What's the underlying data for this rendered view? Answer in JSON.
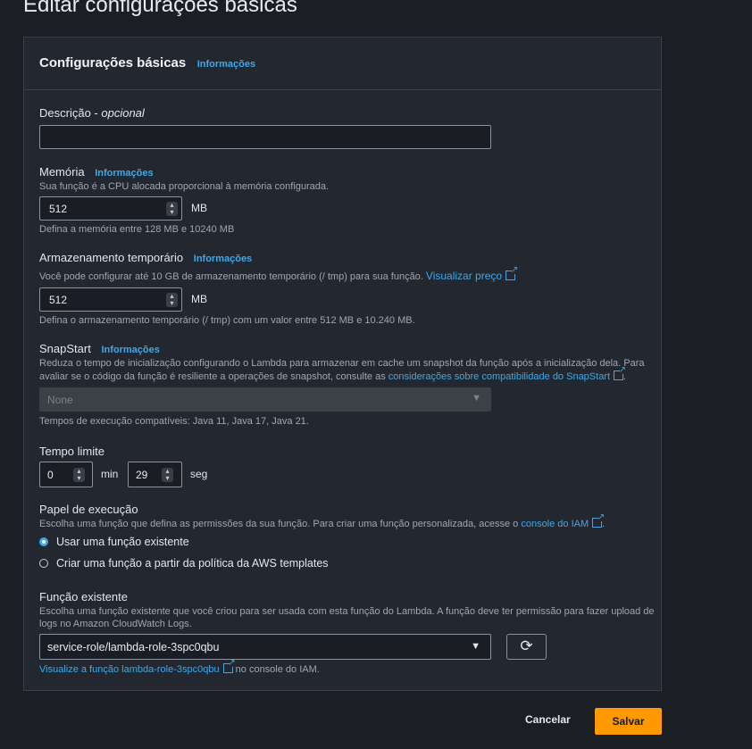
{
  "page": {
    "title": "Editar configurações básicas"
  },
  "panel": {
    "title": "Configurações básicas",
    "info": "Informações"
  },
  "description": {
    "label": "Descrição -",
    "label_optional": "opcional",
    "value": ""
  },
  "memory": {
    "label": "Memória",
    "info": "Informações",
    "help": "Sua função é a CPU alocada proporcional à memória configurada.",
    "value": "512",
    "unit": "MB",
    "constraint": "Defina a memória entre 128 MB e 10240 MB"
  },
  "storage": {
    "label": "Armazenamento temporário",
    "info": "Informações",
    "help": "Você pode configurar até 10 GB de armazenamento temporário (/ tmp) para sua função.",
    "price_link": "Visualizar preço",
    "value": "512",
    "unit": "MB",
    "constraint": "Defina o armazenamento temporário (/ tmp) com um valor entre 512 MB e 10.240 MB."
  },
  "snapstart": {
    "label": "SnapStart",
    "info": "Informações",
    "help_line1": "Reduza o tempo de inicialização configurando o Lambda para armazenar em cache um snapshot da função após a inicialização dela. Para",
    "help_line2": "avaliar se o código da função é resiliente a operações de snapshot, consulte as",
    "help_link": "considerações sobre compatibilidade do SnapStart",
    "help_end": ".",
    "selected": "None",
    "runtimes": "Tempos de execução compatíveis: Java 11, Java 17, Java 21."
  },
  "timeout": {
    "label": "Tempo limite",
    "min_value": "0",
    "min_unit": "min",
    "sec_value": "29",
    "sec_unit": "seg"
  },
  "role": {
    "label": "Papel de execução",
    "help": "Escolha uma função que defina as permissões da sua função. Para criar uma função personalizada, acesse o",
    "help_link": "console do IAM",
    "help_end": ".",
    "options": [
      "Usar uma função existente",
      "Criar uma função a partir da política da AWS templates"
    ],
    "selected_index": 0
  },
  "existing": {
    "label": "Função existente",
    "help_line1": "Escolha uma função existente que você criou para ser usada com esta função do Lambda. A função deve ter permissão para fazer upload de",
    "help_line2": "logs no Amazon CloudWatch Logs.",
    "selected": "service-role/lambda-role-3spc0qbu",
    "view_link": "Visualize a função lambda-role-3spc0qbu",
    "view_suffix": "no console do IAM."
  },
  "actions": {
    "cancel": "Cancelar",
    "save": "Salvar"
  },
  "colors": {
    "accent": "#ff9900",
    "link": "#3fa9e8",
    "panel_bg": "#23272f"
  }
}
